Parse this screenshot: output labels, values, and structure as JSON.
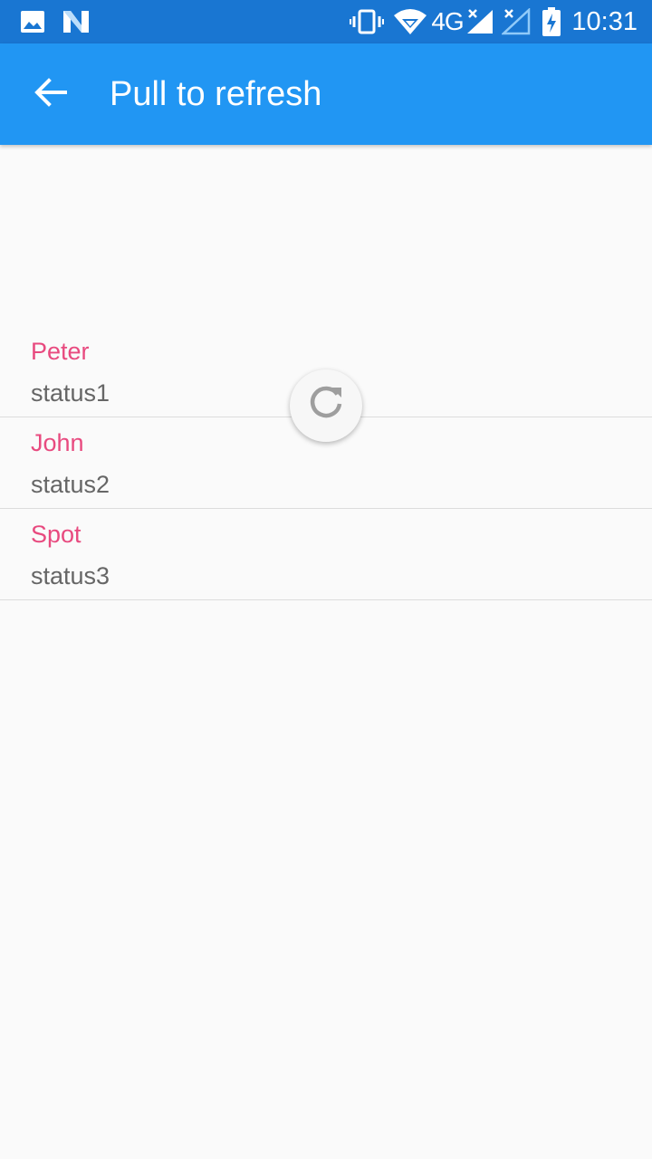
{
  "status_bar": {
    "time": "10:31",
    "network": "4G",
    "icons": [
      "gallery-notification-icon",
      "n-notification-icon",
      "vibrate-icon",
      "wifi-icon",
      "signal-icon",
      "signal-no-service-icon",
      "battery-charging-icon"
    ]
  },
  "app_bar": {
    "title": "Pull to refresh",
    "back_icon": "arrow-left-icon",
    "color": "#2196f3"
  },
  "list": {
    "items": [
      {
        "name": "Peter",
        "status": "status1"
      },
      {
        "name": "John",
        "status": "status2"
      },
      {
        "name": "Spot",
        "status": "status3"
      }
    ],
    "name_color": "#e84a7f"
  },
  "refresh_indicator": {
    "icon": "refresh-icon"
  }
}
